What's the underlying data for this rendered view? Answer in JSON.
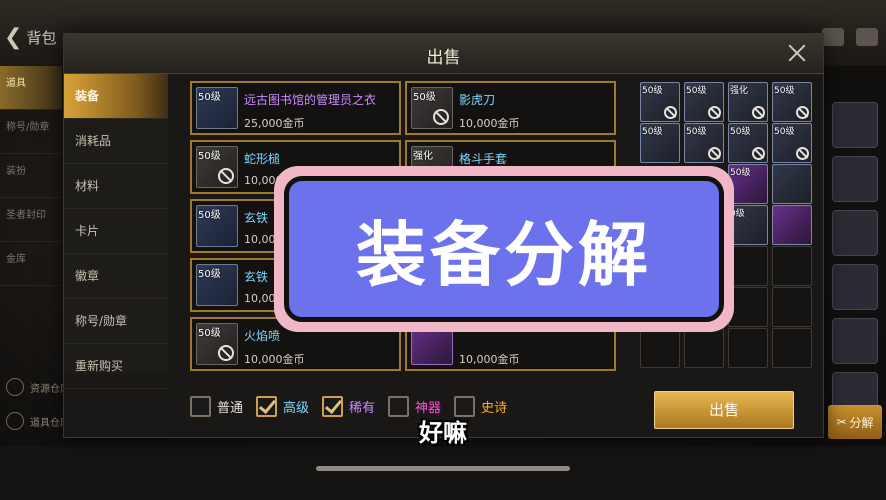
{
  "header": {
    "back_label": "背包"
  },
  "left_bg": {
    "items": [
      "道具",
      "称号/勋章",
      "装扮",
      "圣者封印",
      "金库"
    ],
    "bottom": [
      "资源仓库",
      "道具仓库"
    ]
  },
  "dialog": {
    "title": "出售",
    "categories": [
      "装备",
      "消耗品",
      "材料",
      "卡片",
      "徽章",
      "称号/勋章",
      "重新购买"
    ],
    "items": [
      {
        "level": "50级",
        "name": "远古图书馆的管理员之衣",
        "price": "25,000金币",
        "rarity": "purple"
      },
      {
        "level": "50级",
        "name": "影虎刀",
        "price": "10,000金币",
        "rarity": "blue"
      },
      {
        "level": "50级",
        "name": "蛇形槌",
        "price": "10,000",
        "rarity": "blue"
      },
      {
        "level": "强化",
        "name": "格斗手套",
        "price": "",
        "rarity": "blue"
      },
      {
        "level": "50级",
        "name": "玄铁",
        "price": "10,000",
        "rarity": "blue"
      },
      {
        "level": "",
        "name": "",
        "price": "",
        "rarity": "blue"
      },
      {
        "level": "50级",
        "name": "玄铁",
        "price": "10,000",
        "rarity": "blue"
      },
      {
        "level": "",
        "name": "",
        "price": "",
        "rarity": "blue"
      },
      {
        "level": "50级",
        "name": "火焰喷",
        "price": "10,000金币",
        "rarity": "blue"
      },
      {
        "level": "",
        "name": "",
        "price": "10,000金币",
        "rarity": "blue"
      }
    ],
    "grid_labels": [
      "50级",
      "50级",
      "强化",
      "50级",
      "50级",
      "50级",
      "50级",
      "50级",
      "50级",
      "0级"
    ],
    "filters": [
      {
        "label": "普通",
        "checked": false,
        "color": "#e8e2d6"
      },
      {
        "label": "高级",
        "checked": true,
        "color": "#7fd6ff"
      },
      {
        "label": "稀有",
        "checked": true,
        "color": "#c98bff"
      },
      {
        "label": "神器",
        "checked": false,
        "color": "#ff4fd8"
      },
      {
        "label": "史诗",
        "checked": false,
        "color": "#ffb020"
      }
    ],
    "sell_button": "出售"
  },
  "right_bg": {
    "decompose_label": "分解"
  },
  "overlay": {
    "banner_text": "装备分解",
    "subtitle": "好嘛"
  }
}
